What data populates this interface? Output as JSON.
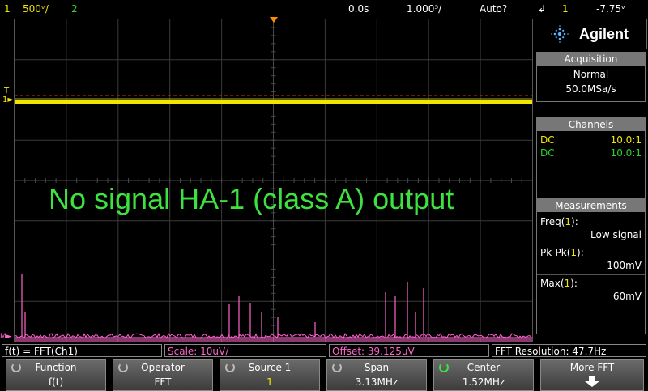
{
  "top": {
    "ch1_num": "1",
    "ch1_scale": "500ᵛ/",
    "ch2_num": "2",
    "time_pos": "0.0s",
    "time_scale": "1.000⁵/",
    "trigger_mode": "Auto?",
    "trigger_icon": "rising-edge-icon",
    "trigger_src": "1",
    "trigger_level": "-7.75ᵛ"
  },
  "brand": {
    "name": "Agilent",
    "logo": "agilent-spark-logo"
  },
  "acquisition": {
    "header": "Acquisition",
    "mode": "Normal",
    "rate": "50.0MSa/s"
  },
  "channels": {
    "header": "Channels",
    "rows": [
      {
        "coupling": "DC",
        "probe": "10.0:1",
        "color": "#f2e600"
      },
      {
        "coupling": "DC",
        "probe": "10.0:1",
        "color": "#2fd12f"
      }
    ]
  },
  "measurements": {
    "header": "Measurements",
    "items": [
      {
        "name": "Freq",
        "ch": "1",
        "value": "Low signal"
      },
      {
        "name": "Pk-Pk",
        "ch": "1",
        "value": "100mV"
      },
      {
        "name": "Max",
        "ch": "1",
        "value": "60mV"
      }
    ]
  },
  "annotation": "No signal HA-1 (class A) output",
  "status": {
    "function": "f(t) = FFT(Ch1)",
    "scale": "Scale: 10uV/",
    "offset": "Offset: 39.125uV",
    "resolution": "FFT Resolution: 47.7Hz"
  },
  "softkeys": [
    {
      "title": "Function",
      "value": "f(t)"
    },
    {
      "title": "Operator",
      "value": "FFT"
    },
    {
      "title": "Source 1",
      "value": "1"
    },
    {
      "title": "Span",
      "value": "3.13MHz"
    },
    {
      "title": "Center",
      "value": "1.52MHz"
    },
    {
      "title": "More FFT",
      "value": ""
    }
  ],
  "colors": {
    "ch1": "#f2e600",
    "ch2": "#2fd12f",
    "math": "#ff66cc",
    "annotation": "#3ee23e"
  }
}
